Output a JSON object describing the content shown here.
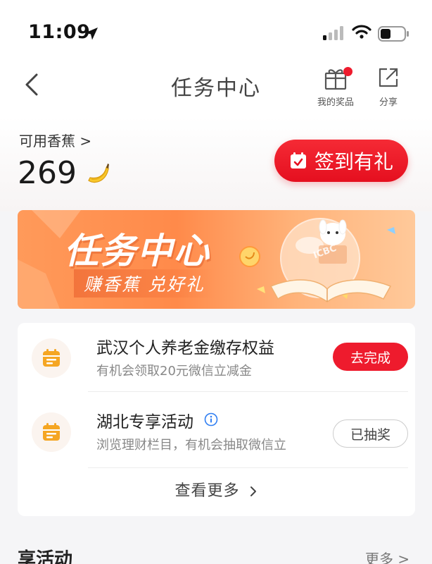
{
  "status_bar": {
    "time": "11:09"
  },
  "nav": {
    "title": "任务中心",
    "prizes_label": "我的奖品",
    "share_label": "分享"
  },
  "banana": {
    "label": "可用香蕉 >",
    "count": "269"
  },
  "checkin_button": "签到有礼",
  "banner": {
    "title": "任务中心",
    "subtitle": "赚香蕉 兑好礼",
    "logo_text": "ICBC"
  },
  "tasks": [
    {
      "title": "武汉个人养老金缴存权益",
      "desc": "有机会领取20元微信立减金",
      "button": "去完成"
    },
    {
      "title": "湖北专享活动",
      "desc": "浏览理财栏目，有机会抽取微信立",
      "button": "已抽奖"
    }
  ],
  "view_more": "查看更多",
  "section": {
    "title": "享活动",
    "more": "更多 >"
  },
  "colors": {
    "primary_red": "#ee1b2d",
    "banner_orange": "#ff8a4a",
    "task_icon_orange": "#f5a623"
  },
  "icons": [
    "location-arrow-icon",
    "signal-icon",
    "wifi-icon",
    "battery-icon",
    "back-icon",
    "gift-icon",
    "share-icon",
    "banana-icon",
    "calendar-icon",
    "task-calendar-icon",
    "info-icon",
    "chevron-right-icon"
  ]
}
